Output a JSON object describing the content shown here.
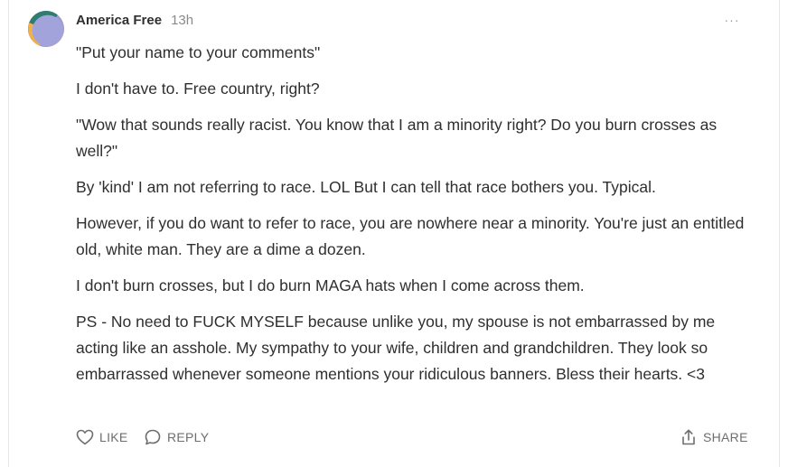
{
  "comment": {
    "author": "America Free",
    "timestamp": "13h",
    "more_label": "···",
    "paragraphs": [
      "\"Put your name to your comments\"",
      "I don't have to. Free country, right?",
      "\"Wow that sounds really racist. You know that I am a minority right? Do you burn crosses as well?\"",
      "By 'kind' I am not referring to race. LOL But I can tell that race bothers you. Typical.",
      "However, if you do want to refer to race, you are nowhere near a minority. You're just an entitled old, white man. They are a dime a dozen.",
      "I don't burn crosses, but I do burn MAGA hats when I come across them.",
      "PS - No need to FUCK MYSELF because unlike you, my spouse is not embarrassed by me acting like an asshole. My sympathy to your wife, children and grandchildren. They look so embarrassed whenever someone mentions your ridiculous banners. Bless their hearts. <3"
    ]
  },
  "actions": {
    "like_label": "LIKE",
    "reply_label": "REPLY",
    "share_label": "SHARE"
  },
  "icons": {
    "like": "heart-icon",
    "reply": "speech-bubble-icon",
    "share": "share-upload-icon",
    "more": "ellipsis-icon"
  },
  "colors": {
    "text": "#2f2f2f",
    "muted": "#8a8a8a",
    "action": "#6e6e6e"
  }
}
